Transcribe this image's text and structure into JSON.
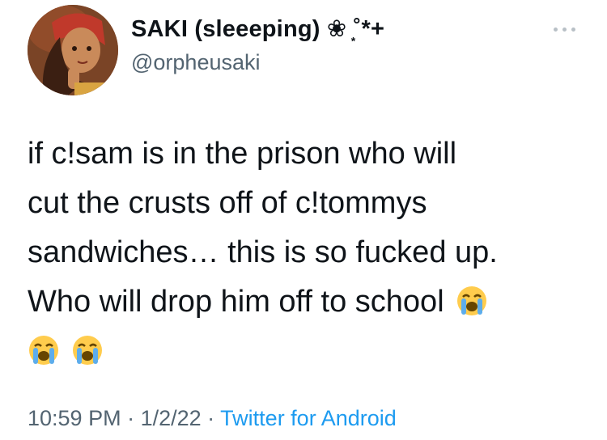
{
  "author": {
    "display_name": "SAKI (sleeeping) ❀ ͙˚*+",
    "handle": "@orpheusaki",
    "avatar_icon": "profile-avatar"
  },
  "tweet": {
    "lines": [
      "if c!sam is in the prison who will",
      "cut the crusts off of c!tommys",
      "sandwiches… this is so fucked up.",
      "Who will drop him off to school"
    ],
    "emoji": "loudly-crying-face"
  },
  "meta": {
    "time": "10:59 PM",
    "separator": " · ",
    "date": "1/2/22",
    "source": "Twitter for Android"
  },
  "colors": {
    "text": "#0f1419",
    "secondary": "#536471",
    "link": "#1d9bf0"
  }
}
